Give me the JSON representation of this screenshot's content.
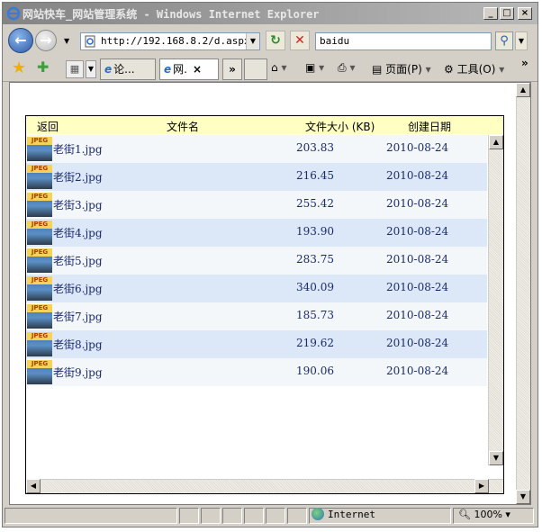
{
  "window": {
    "title": "网站快车_网站管理系统 - Windows Internet Explorer",
    "minimize": "_",
    "maximize": "□",
    "close": "×"
  },
  "addressbar": {
    "url": "http://192.168.8.2/d.aspx",
    "search_text": "baidu"
  },
  "commandbar": {
    "tabs": [
      {
        "label": "论..."
      },
      {
        "label": "网."
      }
    ],
    "overflow": "»",
    "home": "",
    "page_label": "页面(P)",
    "tools_label": "工具(O)",
    "more": "»"
  },
  "table": {
    "headers": {
      "back": "返回",
      "filename": "文件名",
      "size": "文件大小 (KB)",
      "date": "创建日期"
    },
    "thumb_label": "JPEG",
    "rows": [
      {
        "name": "老街1.jpg",
        "size": "203.83",
        "date": "2010-08-24"
      },
      {
        "name": "老街2.jpg",
        "size": "216.45",
        "date": "2010-08-24"
      },
      {
        "name": "老街3.jpg",
        "size": "255.42",
        "date": "2010-08-24"
      },
      {
        "name": "老街4.jpg",
        "size": "193.90",
        "date": "2010-08-24"
      },
      {
        "name": "老街5.jpg",
        "size": "283.75",
        "date": "2010-08-24"
      },
      {
        "name": "老街6.jpg",
        "size": "340.09",
        "date": "2010-08-24"
      },
      {
        "name": "老街7.jpg",
        "size": "185.73",
        "date": "2010-08-24"
      },
      {
        "name": "老街8.jpg",
        "size": "219.62",
        "date": "2010-08-24"
      },
      {
        "name": "老街9.jpg",
        "size": "190.06",
        "date": "2010-08-24"
      }
    ]
  },
  "statusbar": {
    "zone": "Internet",
    "zoom": "100%"
  },
  "colors": {
    "header_bg": "#ffffc4",
    "row_odd": "#f4f7fa",
    "row_even": "#dce8f8",
    "link_text": "#1a2a6a"
  }
}
